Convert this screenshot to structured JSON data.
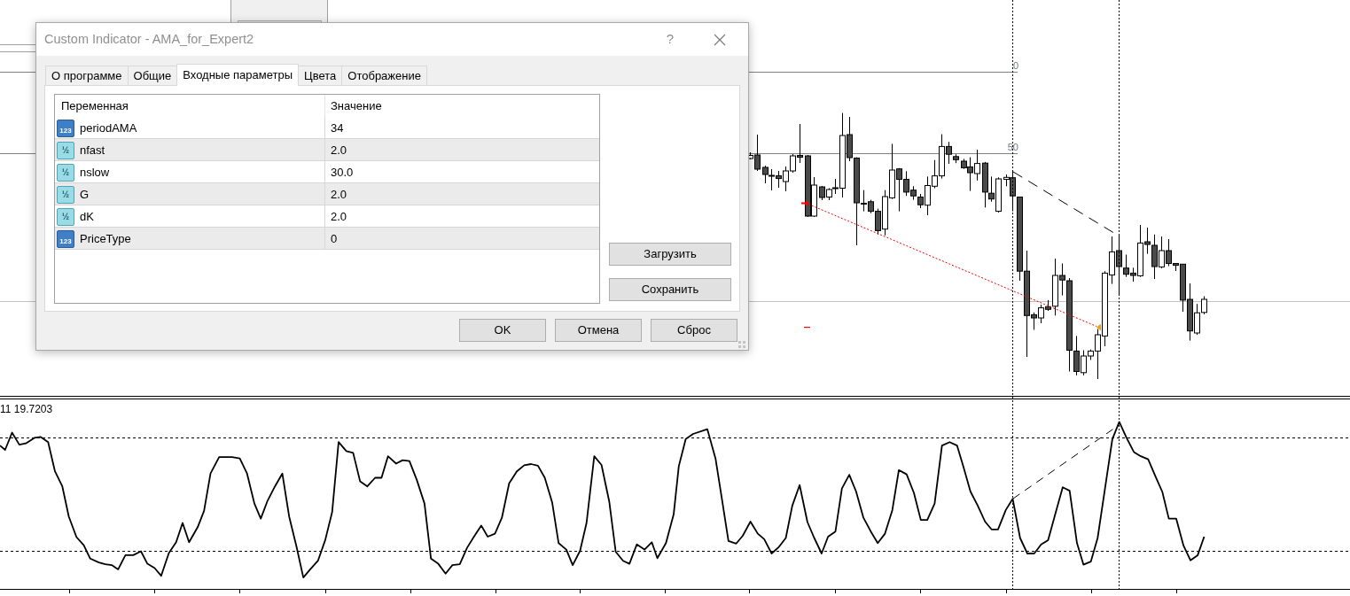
{
  "dialog": {
    "title": "Custom Indicator - AMA_for_Expert2",
    "help": "?"
  },
  "tabs": [
    {
      "label": "О программе",
      "selected": false
    },
    {
      "label": "Общие",
      "selected": false
    },
    {
      "label": "Входные параметры",
      "selected": true
    },
    {
      "label": "Цвета",
      "selected": false
    },
    {
      "label": "Отображение",
      "selected": false
    }
  ],
  "table": {
    "columns": [
      "Переменная",
      "Значение"
    ],
    "rows": [
      {
        "kind": "int",
        "type_mark": "123",
        "name": "periodAMA",
        "value": "34"
      },
      {
        "kind": "double",
        "type_mark": "½",
        "name": "nfast",
        "value": "2.0"
      },
      {
        "kind": "double",
        "type_mark": "½",
        "name": "nslow",
        "value": "30.0"
      },
      {
        "kind": "double",
        "type_mark": "½",
        "name": "G",
        "value": "2.0"
      },
      {
        "kind": "double",
        "type_mark": "½",
        "name": "dK",
        "value": "2.0"
      },
      {
        "kind": "int",
        "type_mark": "123",
        "name": "PriceType",
        "value": "0"
      }
    ]
  },
  "side_buttons": [
    "Загрузить",
    "Сохранить"
  ],
  "footer_buttons": [
    "OK",
    "Отмена",
    "Сброс"
  ],
  "chart": {
    "level_labels": [
      "0",
      "50"
    ],
    "indicator_label": "11 19.7203"
  }
}
